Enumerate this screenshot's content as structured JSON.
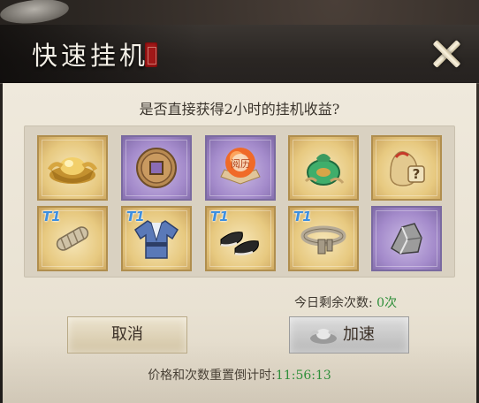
{
  "dialog": {
    "title": "快速挂机",
    "question": "是否直接获得2小时的挂机收益?",
    "remaining_label": "今日剩余次数:",
    "remaining_value": "0次",
    "cancel_label": "取消",
    "accelerate_label": "加速",
    "reset_label": "价格和次数重置倒计时:",
    "reset_time": "11:56:13"
  },
  "rewards": [
    {
      "name": "gold-ingot",
      "rarity": "gold"
    },
    {
      "name": "copper-coin",
      "rarity": "purple"
    },
    {
      "name": "experience-orb",
      "rarity": "purple",
      "label": "阅历"
    },
    {
      "name": "jade-pouch",
      "rarity": "gold"
    },
    {
      "name": "mystery-bag",
      "rarity": "gold",
      "label": "?"
    },
    {
      "name": "arm-wraps",
      "rarity": "gold",
      "tier": "T1"
    },
    {
      "name": "robe",
      "rarity": "gold",
      "tier": "T1"
    },
    {
      "name": "boots",
      "rarity": "gold",
      "tier": "T1"
    },
    {
      "name": "belt",
      "rarity": "gold",
      "tier": "T1"
    },
    {
      "name": "iron-ore",
      "rarity": "purple"
    }
  ],
  "colors": {
    "green_value": "#2f8f3a",
    "tier": "#3d8fe0"
  }
}
